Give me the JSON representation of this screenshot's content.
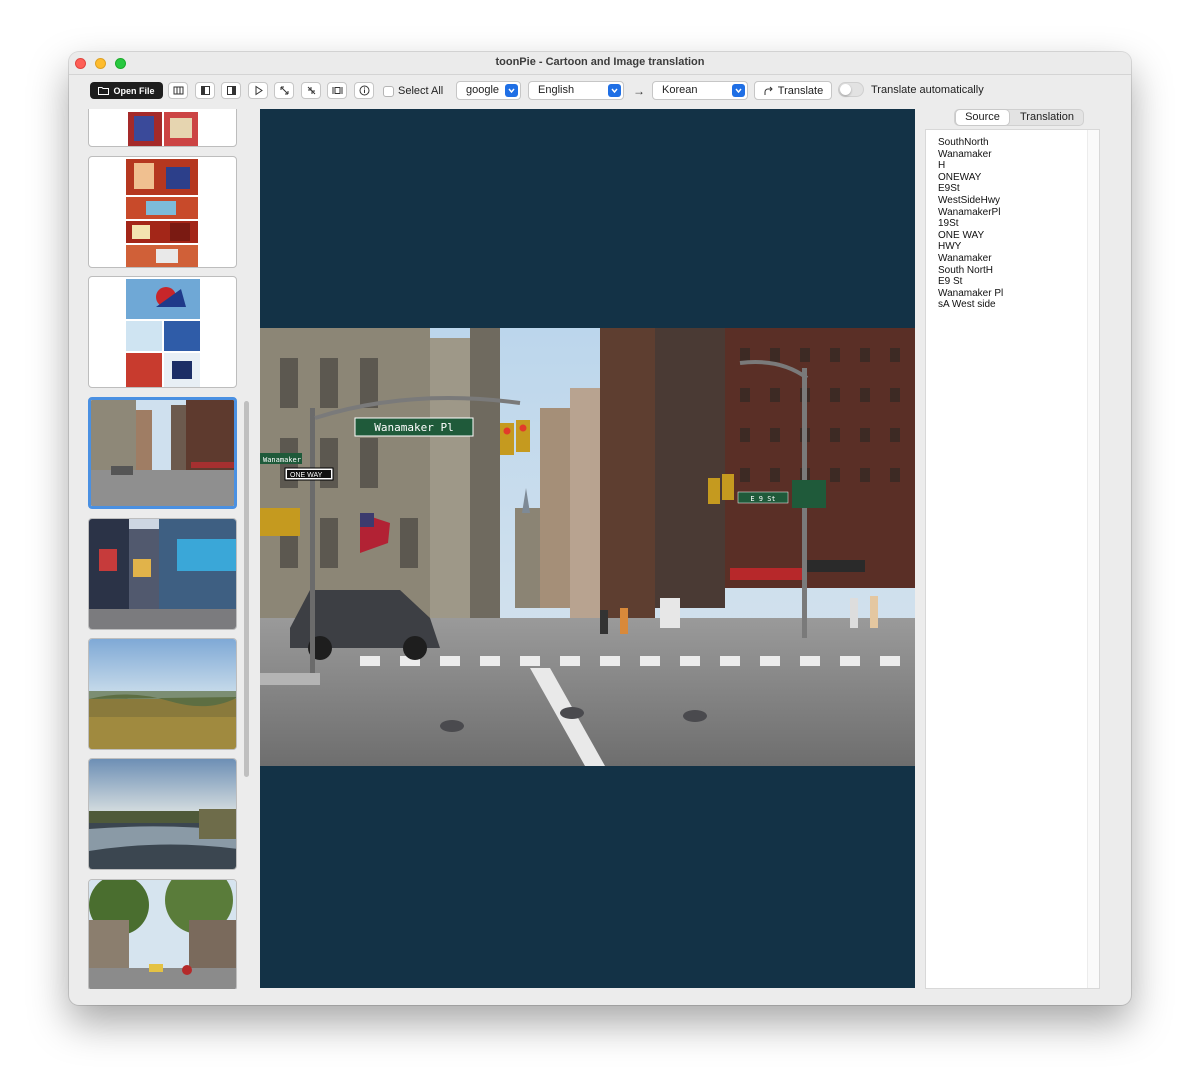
{
  "window": {
    "title": "toonPie - Cartoon and Image translation"
  },
  "toolbar": {
    "open_file_label": "Open File",
    "select_all_label": "Select All",
    "engine_value": "google",
    "source_language": "English",
    "target_language": "Korean",
    "translate_label": "Translate",
    "auto_translate_label": "Translate automatically",
    "auto_translate_on": false
  },
  "sidebar": {
    "thumbnails": [
      {
        "name": "comic page (partial)",
        "selected": false
      },
      {
        "name": "comic page red",
        "selected": false
      },
      {
        "name": "comic page blue",
        "selected": false
      },
      {
        "name": "street Wanamaker Pl",
        "selected": true
      },
      {
        "name": "times square",
        "selected": false
      },
      {
        "name": "field landscape",
        "selected": false
      },
      {
        "name": "river landscape",
        "selected": false
      },
      {
        "name": "tree street",
        "selected": false
      }
    ]
  },
  "viewer": {
    "sign_wanamaker": "Wanamaker Pl",
    "sign_one_way": "ONE WAY",
    "sign_e9": "E 9 St",
    "sign_wanamaker_small": "Wanamaker"
  },
  "panel": {
    "tabs": [
      {
        "label": "Source",
        "active": true
      },
      {
        "label": "Translation",
        "active": false
      }
    ],
    "source_lines": [
      "SouthNorth",
      "Wanamaker",
      "H",
      "ONEWAY",
      "E9St",
      "WestSideHwy",
      "WanamakerPl",
      "19St",
      "ONE WAY",
      "HWY",
      "Wanamaker",
      "South NortH",
      "E9 St",
      "Wanamaker Pl",
      "sA West side"
    ]
  }
}
